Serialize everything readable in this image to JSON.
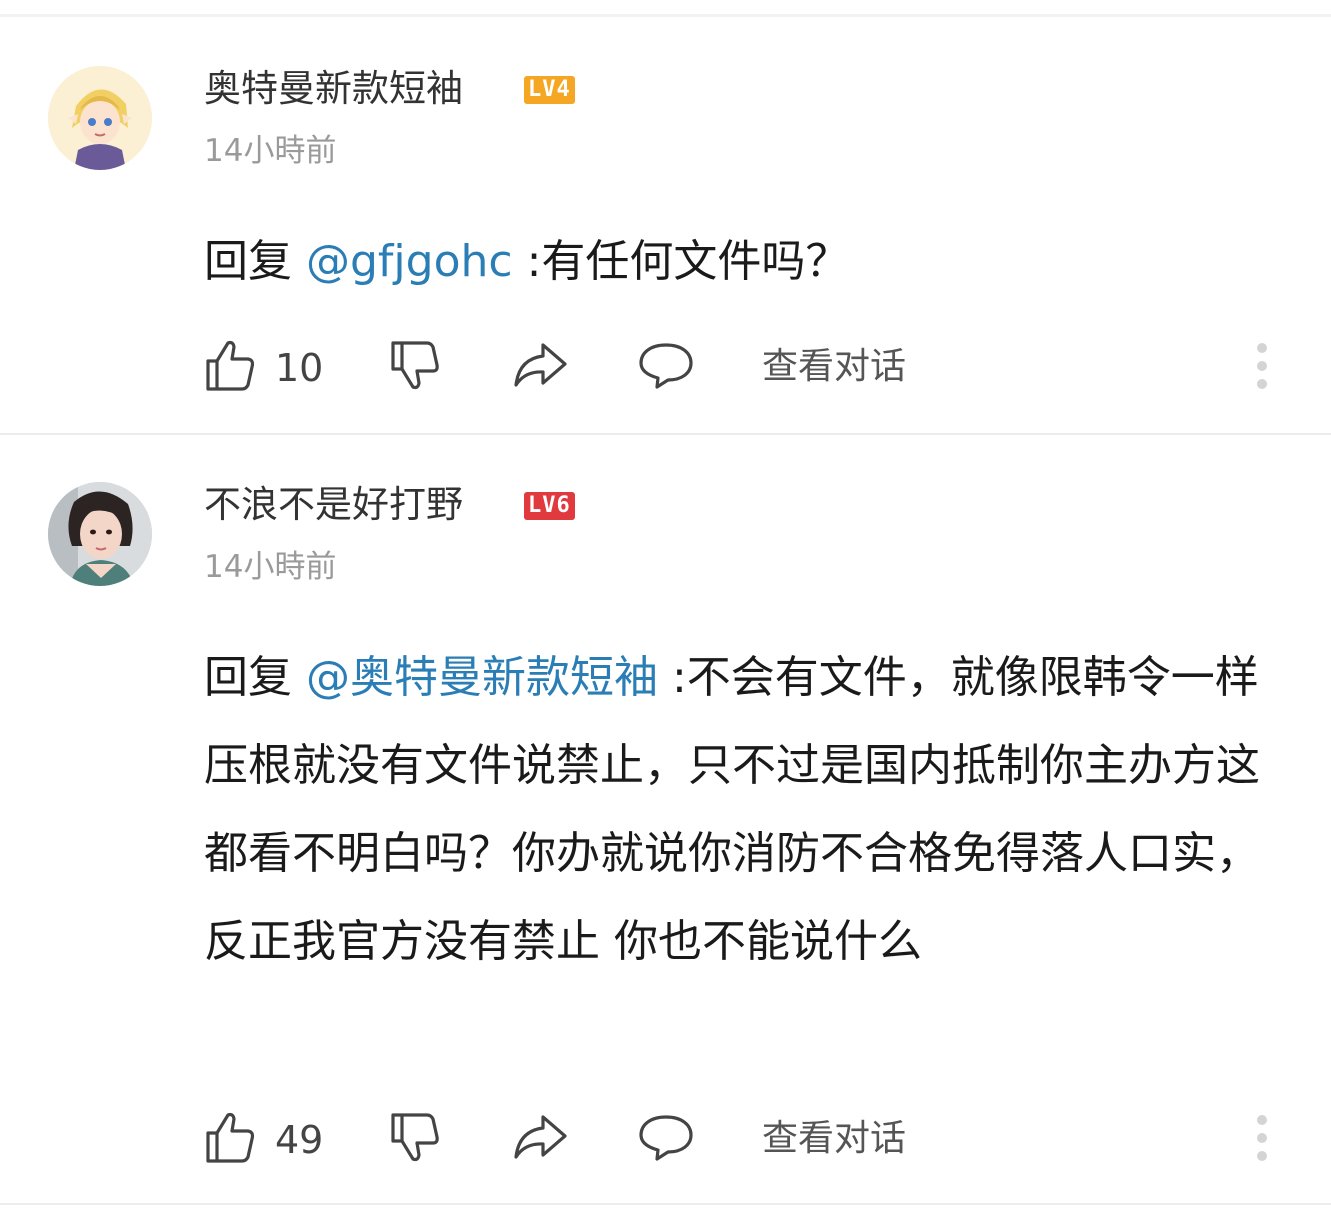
{
  "comments": [
    {
      "username": "奥特曼新款短袖",
      "level": "LV4",
      "level_color": "#f5a623",
      "time": "14小時前",
      "reply_prefix": "回复 ",
      "mention": "@gfjgohc",
      "text": " :有任何文件吗？",
      "likes": "10",
      "view_conversation": "查看对话"
    },
    {
      "username": "不浪不是好打野",
      "level": "LV6",
      "level_color": "#e0393e",
      "time": "14小時前",
      "reply_prefix": "回复 ",
      "mention": "@奥特曼新款短袖",
      "text": " :不会有文件，就像限韩令一样 压根就没有文件说禁止，只不过是国内抵制你主办方这都看不明白吗？你办就说你消防不合格免得落人口实，反正我官方没有禁止 你也不能说什么",
      "likes": "49",
      "view_conversation": "查看对话"
    }
  ]
}
